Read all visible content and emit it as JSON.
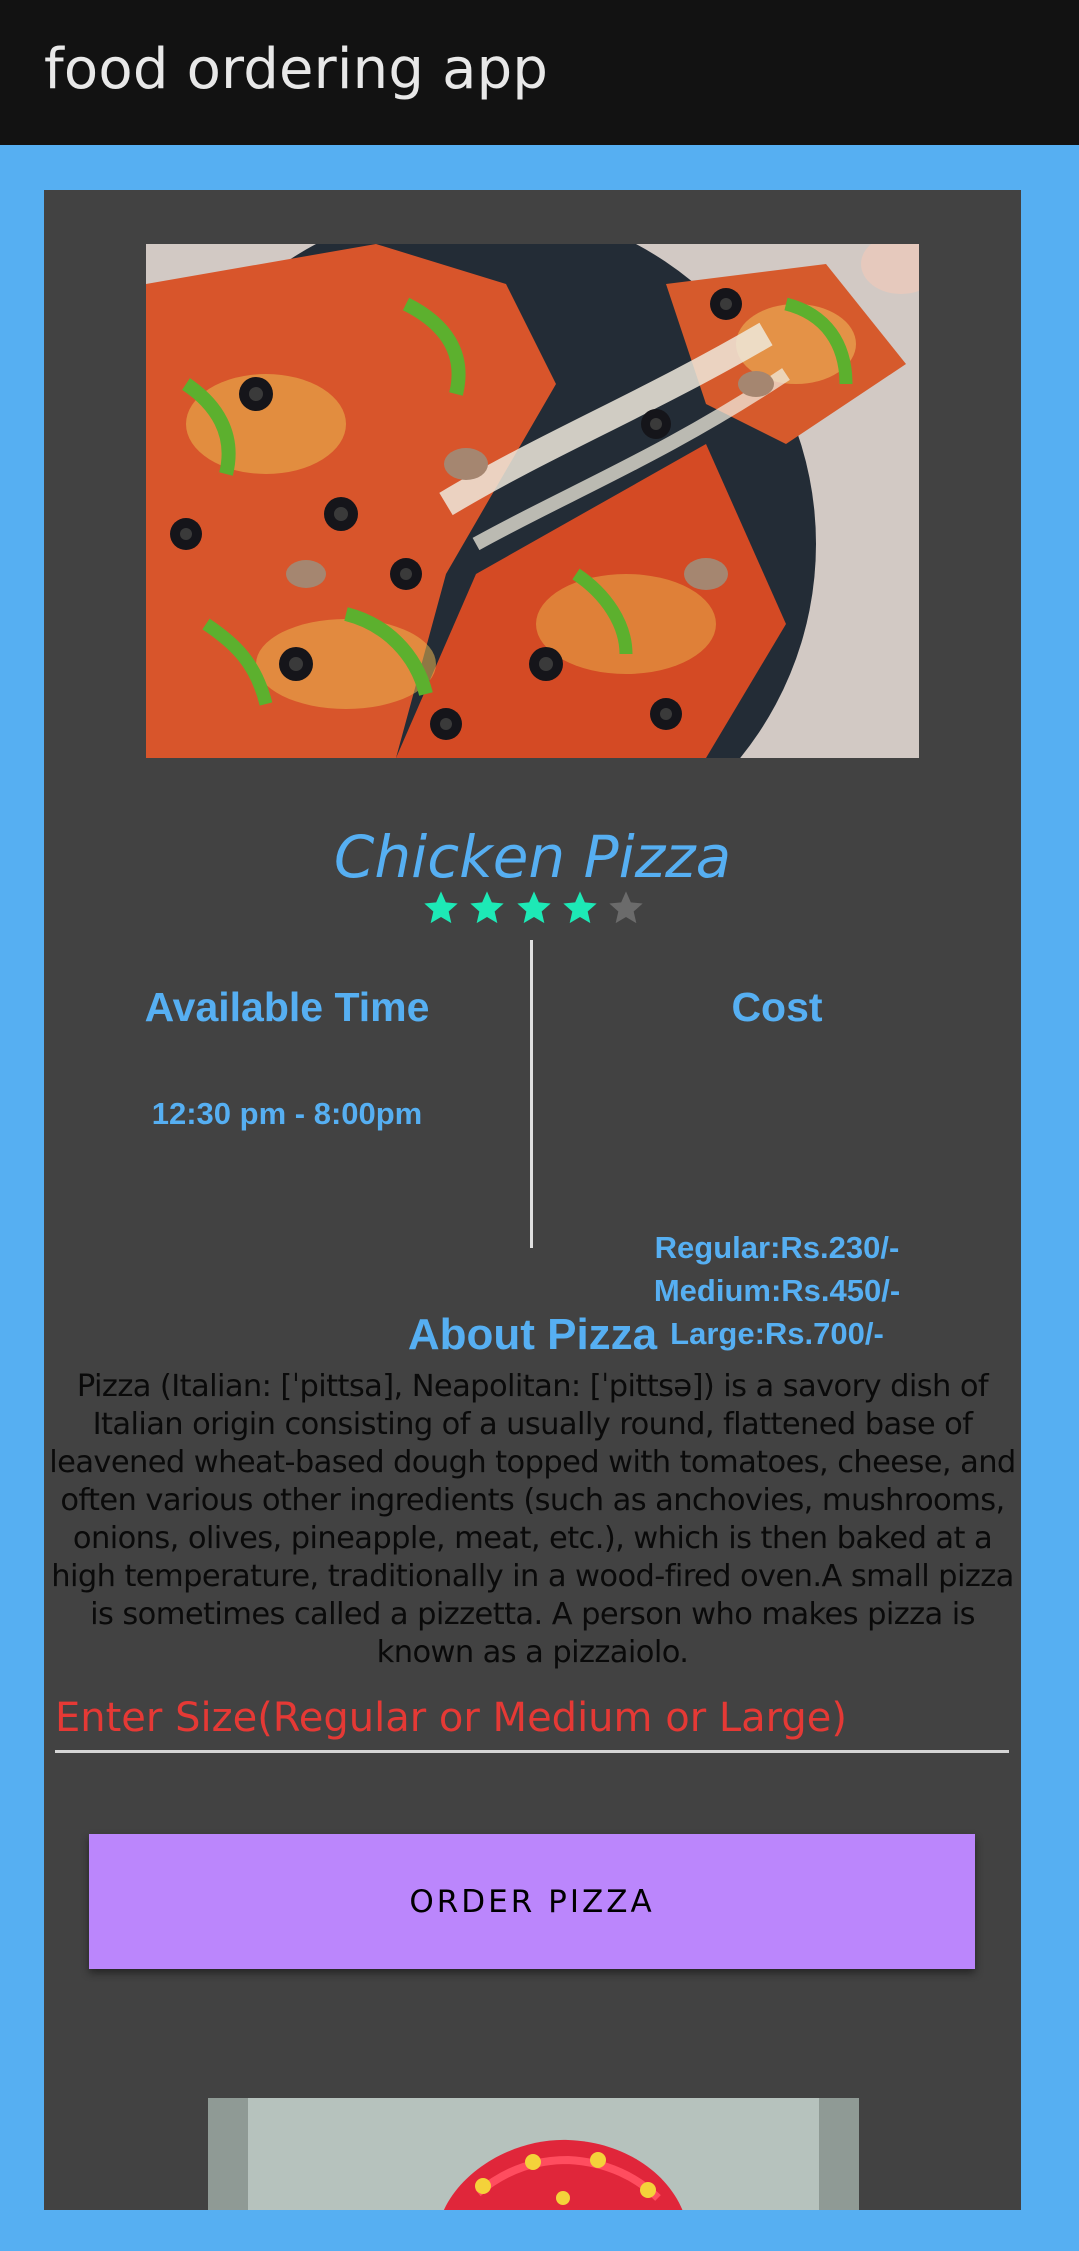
{
  "app_bar": {
    "title": "food ordering app"
  },
  "item": {
    "name": "Chicken Pizza",
    "image_icon": "pizza-photo",
    "rating": 4,
    "rating_max": 5,
    "available_time": {
      "heading": "Available Time",
      "value": "12:30 pm - 8:00pm"
    },
    "cost": {
      "heading": "Cost",
      "regular": "Regular:Rs.230/-",
      "medium": "Medium:Rs.450/-",
      "large": "Large:Rs.700/-"
    },
    "about": {
      "heading": "About Pizza",
      "text": "Pizza (Italian: [ˈpittsa], Neapolitan: [ˈpittsə]) is a savory dish of Italian origin consisting of a usually round, flattened base of leavened wheat-based dough topped with tomatoes, cheese, and often various other ingredients (such as anchovies, mushrooms, onions, olives, pineapple, meat, etc.), which is then baked at a high temperature, traditionally in a wood-fired oven.A small pizza is sometimes called a pizzetta. A person who makes pizza is known as a pizzaiolo."
    },
    "size_input": {
      "placeholder": "Enter Size(Regular or Medium or Large)",
      "value": ""
    },
    "order_button_label": "ORDER PIZZA"
  },
  "next_item": {
    "image_icon": "cake-photo"
  },
  "colors": {
    "background": "#56aff2",
    "app_bar": "#121212",
    "card": "#424242",
    "accent_text": "#56aff2",
    "star_filled": "#1de9b6",
    "star_empty": "#6b6b6b",
    "input_text": "#e53935",
    "button": "#bb86fc"
  }
}
